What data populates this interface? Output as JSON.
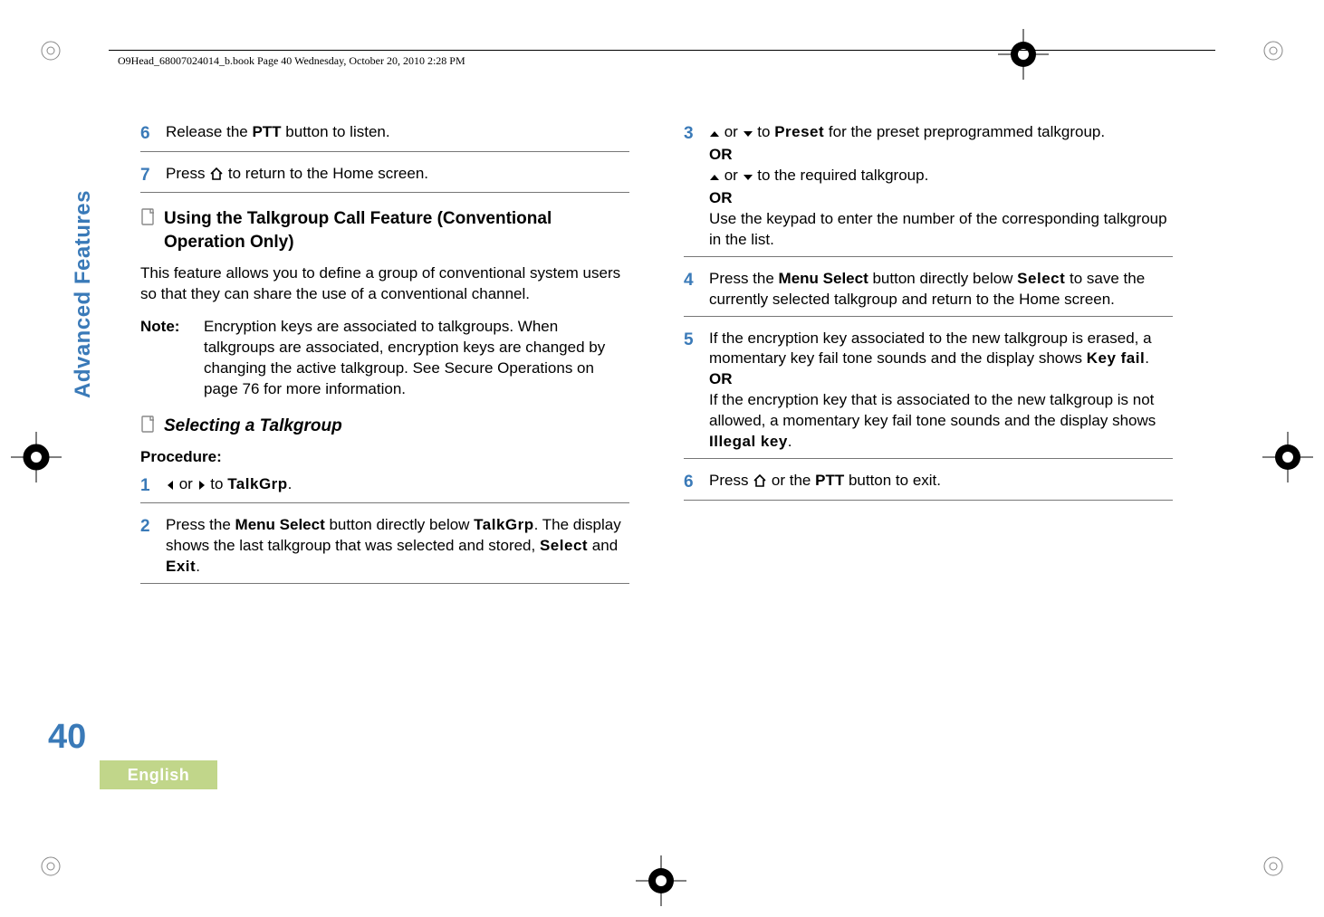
{
  "header": {
    "line": "O9Head_68007024014_b.book  Page 40  Wednesday, October 20, 2010  2:28 PM"
  },
  "sidebar": {
    "label": "Advanced Features",
    "page_number": "40",
    "language": "English"
  },
  "left_col": {
    "step6": "Release the ",
    "step6_bold": "PTT",
    "step6_after": " button to listen.",
    "step7_a": "Press ",
    "step7_b": " to return to the Home screen.",
    "heading1": "Using the Talkgroup Call Feature (Conventional Operation Only)",
    "para1": "This feature allows you to define a group of conventional system users so that they can share the use of a conventional channel.",
    "note_label": "Note:",
    "note_body_a": "Encryption keys are associated to talkgroups. When talkgroups are associated, encryption keys are changed by changing the active talkgroup. See ",
    "note_body_link": "Secure Operations",
    "note_body_b": " on page 76 for more information.",
    "heading2": "Selecting a Talkgroup",
    "procedure": "Procedure:",
    "step1_mid": " or ",
    "step1_to": " to ",
    "step1_tg": "TalkGrp",
    "step1_dot": ".",
    "step2_a": "Press the ",
    "step2_b": "Menu Select",
    "step2_c": " button directly below ",
    "step2_d": "TalkGrp",
    "step2_e": ". The display shows the last talkgroup that was selected and stored, ",
    "step2_f": "Select",
    "step2_g": " and ",
    "step2_h": "Exit",
    "step2_i": "."
  },
  "right_col": {
    "step3_mid": " or ",
    "step3_to": " to ",
    "step3_preset": "Preset",
    "step3_after": " for the preset preprogrammed talkgroup.",
    "or": "OR",
    "step3_line2_mid": " or ",
    "step3_line2_to": " to the required talkgroup.",
    "step3_line3": "Use the keypad to enter the number of the corresponding talkgroup in the list.",
    "step4_a": "Press the ",
    "step4_b": "Menu Select",
    "step4_c": " button directly below ",
    "step4_d": "Select",
    "step4_e": " to save the currently selected talkgroup and return to the Home screen.",
    "step5_a": "If the encryption key associated to the new talkgroup is erased, a momentary key fail tone sounds and the display shows ",
    "step5_b": "Key fail",
    "step5_c": ".",
    "step5_line2": "If the encryption key that is associated to the new talkgroup is not allowed, a momentary key fail tone sounds and the display shows ",
    "step5_line2_b": "Illegal key",
    "step5_line2_c": ".",
    "step6_a": "Press ",
    "step6_b": " or the ",
    "step6_c": "PTT",
    "step6_d": " button to exit."
  }
}
